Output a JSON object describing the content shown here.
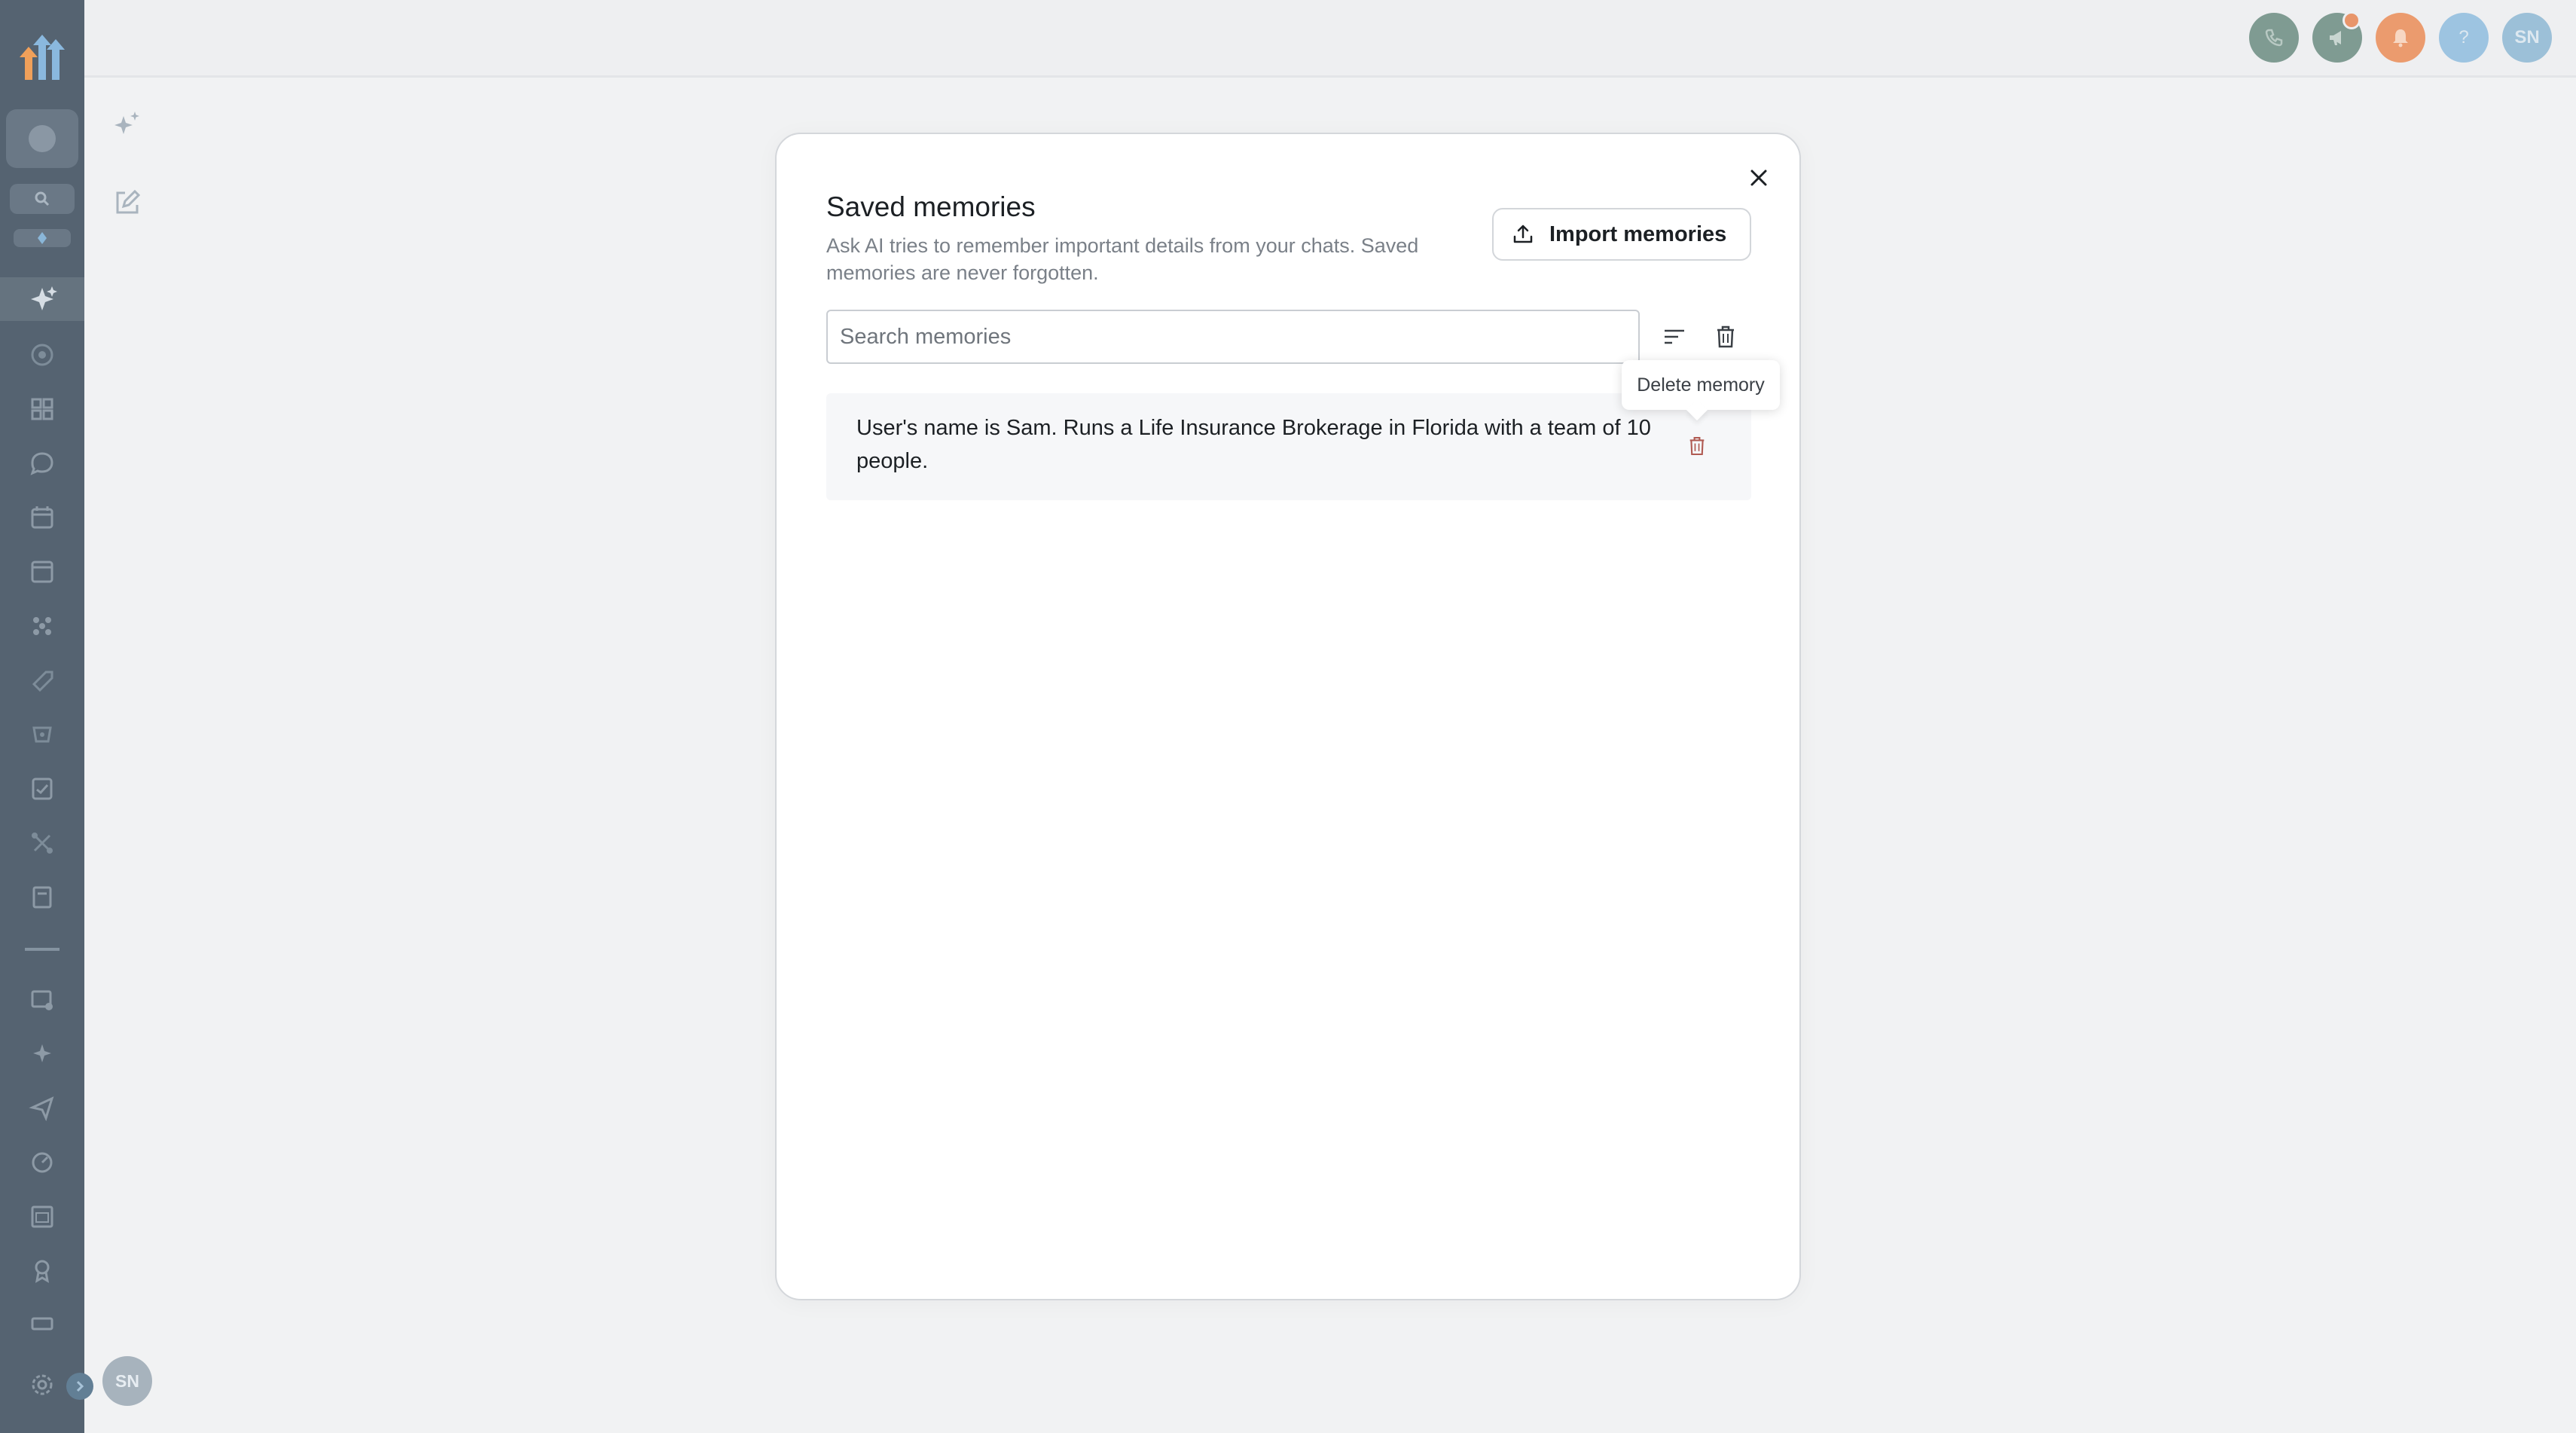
{
  "modal": {
    "title": "Saved memories",
    "description": "Ask AI tries to remember important details from your chats. Saved memories are never forgotten.",
    "import_label": "Import memories",
    "search_placeholder": "Search memories",
    "tooltip": "Delete memory",
    "memories": [
      {
        "text": "User's name is Sam. Runs a Life Insurance Brokerage in Florida with a team of 10 people."
      }
    ]
  },
  "header": {
    "user_initials": "SN",
    "help_label": "?"
  },
  "sidebar": {
    "user_initials": "SN"
  },
  "colors": {
    "sidebar_bg": "#556371",
    "phone_btn": "#7f9b92",
    "announce_btn": "#7f9b92",
    "bell_btn": "#eb9b6e",
    "help_btn": "#9dc4e1",
    "avatar_btn": "#9cc0d8",
    "delete_icon": "#b05a52"
  }
}
